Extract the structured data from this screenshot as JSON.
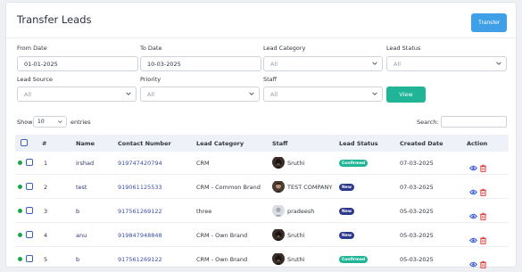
{
  "page": {
    "title": "Transfer Leads",
    "transfer_label": "Transfer"
  },
  "filters": {
    "from_date": {
      "label": "From Date",
      "value": "01-01-2025"
    },
    "to_date": {
      "label": "To Date",
      "value": "10-03-2025"
    },
    "lead_category": {
      "label": "Lead Category",
      "value": "All"
    },
    "lead_status": {
      "label": "Lead Status",
      "value": "All"
    },
    "lead_source": {
      "label": "Lead Source",
      "value": "All"
    },
    "priority": {
      "label": "Priority",
      "value": "All"
    },
    "staff": {
      "label": "Staff",
      "value": "All"
    },
    "view_label": "View"
  },
  "table_controls": {
    "show_label": "Show",
    "entries_value": "10",
    "entries_label": "entries",
    "search_label": "Search:"
  },
  "table": {
    "headers": [
      "#",
      "Name",
      "Contact Number",
      "Lead Category",
      "Staff",
      "Lead Status",
      "Created Date",
      "Action"
    ],
    "rows": [
      {
        "num": "1",
        "name": "irshad",
        "contact": "919747420794",
        "category": "CRM",
        "staff": "Sruthi",
        "avatar": "photo",
        "status": "Confirmed",
        "status_type": "confirmed",
        "date": "07-03-2025"
      },
      {
        "num": "2",
        "name": "test",
        "contact": "919061125533",
        "category": "CRM - Common Brand",
        "staff": "TEST COMPANY",
        "avatar": "photo2",
        "status": "New",
        "status_type": "new",
        "date": "07-03-2025"
      },
      {
        "num": "3",
        "name": "b",
        "contact": "917561269122",
        "category": "three",
        "staff": "pradeesh",
        "avatar": "placeholder",
        "status": "New",
        "status_type": "new",
        "date": "05-03-2025"
      },
      {
        "num": "4",
        "name": "anu",
        "contact": "919847948848",
        "category": "CRM - Own Brand",
        "staff": "Sruthi",
        "avatar": "photo",
        "status": "New",
        "status_type": "new",
        "date": "05-03-2025"
      },
      {
        "num": "5",
        "name": "b",
        "contact": "917561269122",
        "category": "CRM - Own Brand",
        "staff": "Sruthi",
        "avatar": "photo",
        "status": "Confirmed",
        "status_type": "confirmed",
        "date": "05-03-2025"
      }
    ]
  },
  "colors": {
    "primary": "#3fa0e8",
    "view_button": "#1fb596",
    "confirmed": "#1fb596",
    "new": "#2d3a8c",
    "view_icon": "#3b5bd9",
    "delete_icon": "#e03b3b",
    "active_dot": "#1aa54a"
  }
}
